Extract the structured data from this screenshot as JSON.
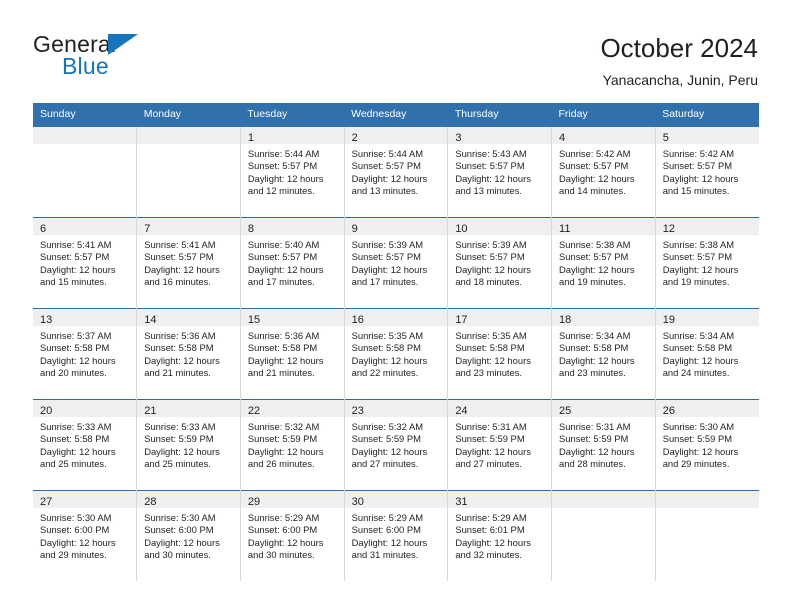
{
  "brand": {
    "name_part1": "General",
    "name_part2": "Blue",
    "flag_icon": "triangle-flag-icon"
  },
  "header": {
    "title": "October 2024",
    "subtitle": "Yanacancha, Junin, Peru"
  },
  "colors": {
    "header_row_bg": "#3071ad",
    "header_row_text": "#ffffff",
    "day_band_bg": "#efefef",
    "cell_border": "#2e6da4",
    "brand_blue": "#1675bc",
    "text": "#231f20"
  },
  "weekdays": [
    "Sunday",
    "Monday",
    "Tuesday",
    "Wednesday",
    "Thursday",
    "Friday",
    "Saturday"
  ],
  "weeks": [
    [
      {
        "day": "",
        "empty": true,
        "sunrise": "",
        "sunset": "",
        "daylight_line1": "",
        "daylight_line2": ""
      },
      {
        "day": "",
        "empty": true,
        "sunrise": "",
        "sunset": "",
        "daylight_line1": "",
        "daylight_line2": ""
      },
      {
        "day": "1",
        "empty": false,
        "sunrise": "Sunrise: 5:44 AM",
        "sunset": "Sunset: 5:57 PM",
        "daylight_line1": "Daylight: 12 hours",
        "daylight_line2": "and 12 minutes."
      },
      {
        "day": "2",
        "empty": false,
        "sunrise": "Sunrise: 5:44 AM",
        "sunset": "Sunset: 5:57 PM",
        "daylight_line1": "Daylight: 12 hours",
        "daylight_line2": "and 13 minutes."
      },
      {
        "day": "3",
        "empty": false,
        "sunrise": "Sunrise: 5:43 AM",
        "sunset": "Sunset: 5:57 PM",
        "daylight_line1": "Daylight: 12 hours",
        "daylight_line2": "and 13 minutes."
      },
      {
        "day": "4",
        "empty": false,
        "sunrise": "Sunrise: 5:42 AM",
        "sunset": "Sunset: 5:57 PM",
        "daylight_line1": "Daylight: 12 hours",
        "daylight_line2": "and 14 minutes."
      },
      {
        "day": "5",
        "empty": false,
        "sunrise": "Sunrise: 5:42 AM",
        "sunset": "Sunset: 5:57 PM",
        "daylight_line1": "Daylight: 12 hours",
        "daylight_line2": "and 15 minutes."
      }
    ],
    [
      {
        "day": "6",
        "empty": false,
        "sunrise": "Sunrise: 5:41 AM",
        "sunset": "Sunset: 5:57 PM",
        "daylight_line1": "Daylight: 12 hours",
        "daylight_line2": "and 15 minutes."
      },
      {
        "day": "7",
        "empty": false,
        "sunrise": "Sunrise: 5:41 AM",
        "sunset": "Sunset: 5:57 PM",
        "daylight_line1": "Daylight: 12 hours",
        "daylight_line2": "and 16 minutes."
      },
      {
        "day": "8",
        "empty": false,
        "sunrise": "Sunrise: 5:40 AM",
        "sunset": "Sunset: 5:57 PM",
        "daylight_line1": "Daylight: 12 hours",
        "daylight_line2": "and 17 minutes."
      },
      {
        "day": "9",
        "empty": false,
        "sunrise": "Sunrise: 5:39 AM",
        "sunset": "Sunset: 5:57 PM",
        "daylight_line1": "Daylight: 12 hours",
        "daylight_line2": "and 17 minutes."
      },
      {
        "day": "10",
        "empty": false,
        "sunrise": "Sunrise: 5:39 AM",
        "sunset": "Sunset: 5:57 PM",
        "daylight_line1": "Daylight: 12 hours",
        "daylight_line2": "and 18 minutes."
      },
      {
        "day": "11",
        "empty": false,
        "sunrise": "Sunrise: 5:38 AM",
        "sunset": "Sunset: 5:57 PM",
        "daylight_line1": "Daylight: 12 hours",
        "daylight_line2": "and 19 minutes."
      },
      {
        "day": "12",
        "empty": false,
        "sunrise": "Sunrise: 5:38 AM",
        "sunset": "Sunset: 5:57 PM",
        "daylight_line1": "Daylight: 12 hours",
        "daylight_line2": "and 19 minutes."
      }
    ],
    [
      {
        "day": "13",
        "empty": false,
        "sunrise": "Sunrise: 5:37 AM",
        "sunset": "Sunset: 5:58 PM",
        "daylight_line1": "Daylight: 12 hours",
        "daylight_line2": "and 20 minutes."
      },
      {
        "day": "14",
        "empty": false,
        "sunrise": "Sunrise: 5:36 AM",
        "sunset": "Sunset: 5:58 PM",
        "daylight_line1": "Daylight: 12 hours",
        "daylight_line2": "and 21 minutes."
      },
      {
        "day": "15",
        "empty": false,
        "sunrise": "Sunrise: 5:36 AM",
        "sunset": "Sunset: 5:58 PM",
        "daylight_line1": "Daylight: 12 hours",
        "daylight_line2": "and 21 minutes."
      },
      {
        "day": "16",
        "empty": false,
        "sunrise": "Sunrise: 5:35 AM",
        "sunset": "Sunset: 5:58 PM",
        "daylight_line1": "Daylight: 12 hours",
        "daylight_line2": "and 22 minutes."
      },
      {
        "day": "17",
        "empty": false,
        "sunrise": "Sunrise: 5:35 AM",
        "sunset": "Sunset: 5:58 PM",
        "daylight_line1": "Daylight: 12 hours",
        "daylight_line2": "and 23 minutes."
      },
      {
        "day": "18",
        "empty": false,
        "sunrise": "Sunrise: 5:34 AM",
        "sunset": "Sunset: 5:58 PM",
        "daylight_line1": "Daylight: 12 hours",
        "daylight_line2": "and 23 minutes."
      },
      {
        "day": "19",
        "empty": false,
        "sunrise": "Sunrise: 5:34 AM",
        "sunset": "Sunset: 5:58 PM",
        "daylight_line1": "Daylight: 12 hours",
        "daylight_line2": "and 24 minutes."
      }
    ],
    [
      {
        "day": "20",
        "empty": false,
        "sunrise": "Sunrise: 5:33 AM",
        "sunset": "Sunset: 5:58 PM",
        "daylight_line1": "Daylight: 12 hours",
        "daylight_line2": "and 25 minutes."
      },
      {
        "day": "21",
        "empty": false,
        "sunrise": "Sunrise: 5:33 AM",
        "sunset": "Sunset: 5:59 PM",
        "daylight_line1": "Daylight: 12 hours",
        "daylight_line2": "and 25 minutes."
      },
      {
        "day": "22",
        "empty": false,
        "sunrise": "Sunrise: 5:32 AM",
        "sunset": "Sunset: 5:59 PM",
        "daylight_line1": "Daylight: 12 hours",
        "daylight_line2": "and 26 minutes."
      },
      {
        "day": "23",
        "empty": false,
        "sunrise": "Sunrise: 5:32 AM",
        "sunset": "Sunset: 5:59 PM",
        "daylight_line1": "Daylight: 12 hours",
        "daylight_line2": "and 27 minutes."
      },
      {
        "day": "24",
        "empty": false,
        "sunrise": "Sunrise: 5:31 AM",
        "sunset": "Sunset: 5:59 PM",
        "daylight_line1": "Daylight: 12 hours",
        "daylight_line2": "and 27 minutes."
      },
      {
        "day": "25",
        "empty": false,
        "sunrise": "Sunrise: 5:31 AM",
        "sunset": "Sunset: 5:59 PM",
        "daylight_line1": "Daylight: 12 hours",
        "daylight_line2": "and 28 minutes."
      },
      {
        "day": "26",
        "empty": false,
        "sunrise": "Sunrise: 5:30 AM",
        "sunset": "Sunset: 5:59 PM",
        "daylight_line1": "Daylight: 12 hours",
        "daylight_line2": "and 29 minutes."
      }
    ],
    [
      {
        "day": "27",
        "empty": false,
        "sunrise": "Sunrise: 5:30 AM",
        "sunset": "Sunset: 6:00 PM",
        "daylight_line1": "Daylight: 12 hours",
        "daylight_line2": "and 29 minutes."
      },
      {
        "day": "28",
        "empty": false,
        "sunrise": "Sunrise: 5:30 AM",
        "sunset": "Sunset: 6:00 PM",
        "daylight_line1": "Daylight: 12 hours",
        "daylight_line2": "and 30 minutes."
      },
      {
        "day": "29",
        "empty": false,
        "sunrise": "Sunrise: 5:29 AM",
        "sunset": "Sunset: 6:00 PM",
        "daylight_line1": "Daylight: 12 hours",
        "daylight_line2": "and 30 minutes."
      },
      {
        "day": "30",
        "empty": false,
        "sunrise": "Sunrise: 5:29 AM",
        "sunset": "Sunset: 6:00 PM",
        "daylight_line1": "Daylight: 12 hours",
        "daylight_line2": "and 31 minutes."
      },
      {
        "day": "31",
        "empty": false,
        "sunrise": "Sunrise: 5:29 AM",
        "sunset": "Sunset: 6:01 PM",
        "daylight_line1": "Daylight: 12 hours",
        "daylight_line2": "and 32 minutes."
      },
      {
        "day": "",
        "empty": true,
        "sunrise": "",
        "sunset": "",
        "daylight_line1": "",
        "daylight_line2": ""
      },
      {
        "day": "",
        "empty": true,
        "sunrise": "",
        "sunset": "",
        "daylight_line1": "",
        "daylight_line2": ""
      }
    ]
  ]
}
